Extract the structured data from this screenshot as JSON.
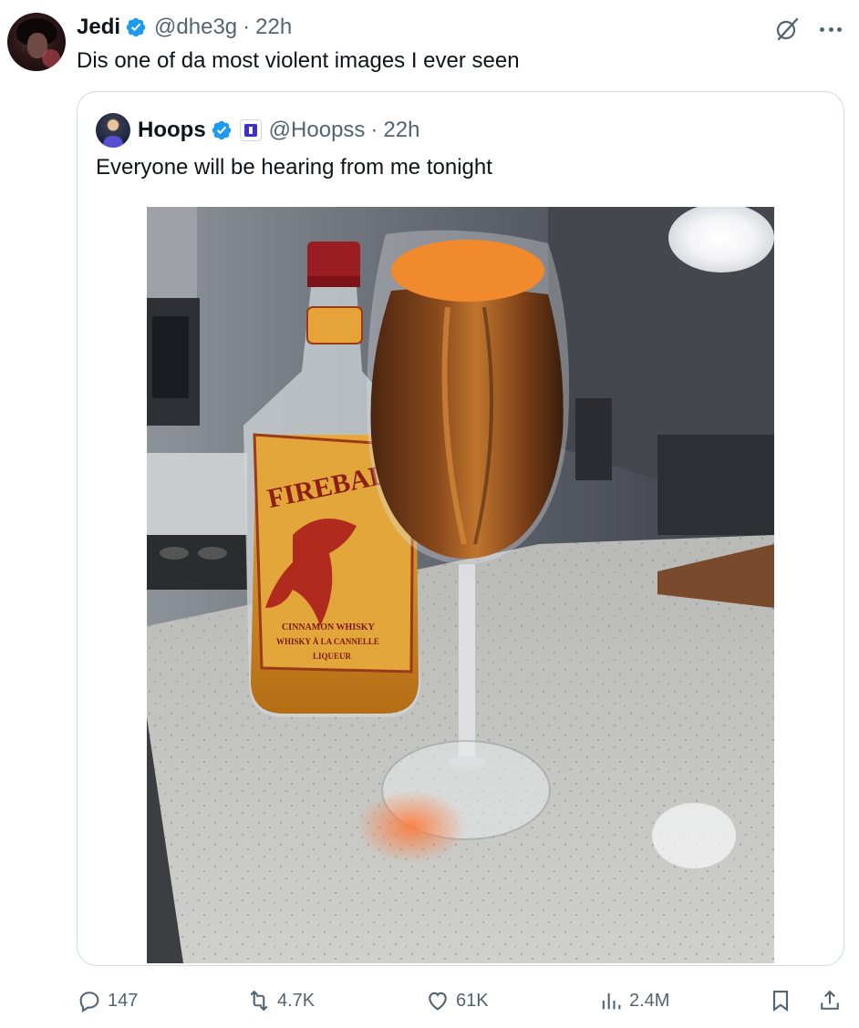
{
  "tweet": {
    "author_name": "Jedi",
    "handle": "@dhe3g",
    "separator": "·",
    "time": "22h",
    "text": "Dis one of da most violent images I ever seen"
  },
  "quoted_tweet": {
    "author_name": "Hoops",
    "handle": "@Hoopss",
    "separator": "·",
    "time": "22h",
    "text": "Everyone will be hearing from me tonight",
    "image_label_lines": [
      "FIREBALL",
      "CINNAMON WHISKY",
      "WHISKY À LA CANNELLE",
      "LIQUEUR"
    ]
  },
  "actions": {
    "replies": "147",
    "reposts": "4.7K",
    "likes": "61K",
    "views": "2.4M"
  },
  "colors": {
    "text": "#0f1419",
    "secondary": "#536471",
    "verified": "#1d9bf0",
    "border": "#cfd9de"
  },
  "icons": [
    "verified-badge-icon",
    "grok-icon",
    "more-icon",
    "affiliate-badge-icon",
    "reply-icon",
    "repost-icon",
    "like-icon",
    "views-icon",
    "bookmark-icon",
    "share-icon"
  ]
}
